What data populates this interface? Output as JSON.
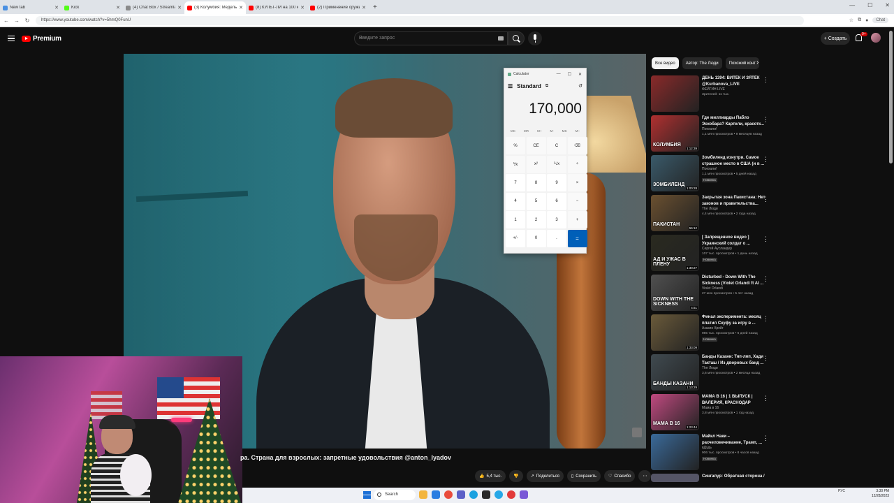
{
  "browser": {
    "tabs": [
      {
        "title": "New tab",
        "color": "#4a90e2",
        "active": false
      },
      {
        "title": "Kick",
        "color": "#53fc18",
        "active": false
      },
      {
        "title": "(4) Chat Box / Streamlabs",
        "color": "#8a8a8a",
        "active": false
      },
      {
        "title": "(3) Колумбия: Медельин Родин",
        "color": "#ff0000",
        "active": true
      },
      {
        "title": "(8) КУЛЬТ-ЛИ на 100 кг. МЫ ПРИ",
        "color": "#ff0000",
        "active": false
      },
      {
        "title": "(2) Применение оружия на ссаде",
        "color": "#ff0000",
        "active": false
      }
    ],
    "new_tab": "+",
    "url": "https://www.youtube.com/watch?v=5hmQ0FunU",
    "chat_button": "Chat"
  },
  "header": {
    "logo_text": "Premium",
    "search_placeholder": "Введите запрос",
    "create_label": "Создать",
    "notification_count": "9+"
  },
  "calculator": {
    "window_title": "Calculator",
    "mode": "Standard",
    "display": "170,000",
    "memory": [
      "MC",
      "MR",
      "M+",
      "M-",
      "MS",
      "M~"
    ],
    "keys": [
      "%",
      "CE",
      "C",
      "⌫",
      "⅟x",
      "x²",
      "²√x",
      "÷",
      "7",
      "8",
      "9",
      "×",
      "4",
      "5",
      "6",
      "−",
      "1",
      "2",
      "3",
      "+",
      "+/-",
      "0",
      ".",
      "="
    ]
  },
  "sidebar": {
    "chips": [
      "Все видео",
      "Автор: The Люди",
      "Похожий конт"
    ],
    "recommendations": [
      {
        "title": "ДЕНЬ 1394: ВИТЁК И ЗЯТЁК @Kurbanova_LIVE",
        "channel": "ФЕЙГИН LIVE",
        "meta": "Зрителей: 11 тыс.",
        "duration": "",
        "new": false,
        "thumb_text": "",
        "thumb_color": "#8a2a2a"
      },
      {
        "title": "Где миллиарды Пабло Эскобара? Картели, красотк...",
        "channel": "Поехали!",
        "meta": "1,1 млн просмотров • 9 месяцев назад",
        "duration": "1:12:39",
        "new": false,
        "thumb_text": "КОЛУМБИЯ",
        "thumb_color": "#b03030"
      },
      {
        "title": "Зомбиленд изнутри. Самое страшное место в США (и в ...",
        "channel": "Поехали!",
        "meta": "1,1 млн просмотров • 5 дней назад",
        "duration": "1:00:28",
        "new": true,
        "thumb_text": "ЗОМБИЛЕНД",
        "thumb_color": "#3a5a6a"
      },
      {
        "title": "Закрытая зона Пакистана: Нет законов и правительства...",
        "channel": "The Люди",
        "meta": "4,4 млн просмотров • 2 года назад",
        "duration": "56:12",
        "new": false,
        "thumb_text": "ПАКИСТАН",
        "thumb_color": "#6a5030"
      },
      {
        "title": "[ Запрещенное видео ] Украинский солдат о ...",
        "channel": "Сергей Аусландер",
        "meta": "107 тыс. просмотров • 1 день назад",
        "duration": "1:30:27",
        "new": true,
        "thumb_text": "АД И УЖАС В ПЛЕНУ",
        "thumb_color": "#2a2a20"
      },
      {
        "title": "Disturbed - Down With The Sickness (Violet Orlandi ft AI ...",
        "channel": "Violet Orlandi",
        "meta": "27 млн просмотров • 5 лет назад",
        "duration": "4:51",
        "new": false,
        "thumb_text": "DOWN WITH THE SICKNESS",
        "thumb_color": "#505050"
      },
      {
        "title": "Финал эксперимента: месяц платил Скуфу за игру в ...",
        "channel": "Азазин Крейг",
        "meta": "985 тыс. просмотров • 6 дней назад",
        "duration": "1:33:09",
        "new": true,
        "thumb_text": "",
        "thumb_color": "#6a5a3a"
      },
      {
        "title": "Банды Казани: Тяп-ляп, Хади Такташ / Из дворовых банд ...",
        "channel": "The Люди",
        "meta": "3,6 млн просмотров • 2 месяца назад",
        "duration": "1:13:29",
        "new": false,
        "thumb_text": "БАНДЫ КАЗАНИ",
        "thumb_color": "#404a50"
      },
      {
        "title": "МАМА В 16 | 1 ВЫПУСК | ВАЛЕРИЯ, КРАСНОДАР",
        "channel": "Мама в 16",
        "meta": "3,8 млн просмотров • 1 год назад",
        "duration": "1:23:44",
        "new": false,
        "thumb_text": "МАМА В 16",
        "thumb_color": "#c04a80"
      },
      {
        "title": "Майкл Наки – расчеловечивание, Трамп, ...",
        "channel": "вДудь",
        "meta": "906 тыс. просмотров • 8 часов назад",
        "duration": "",
        "new": true,
        "thumb_text": "",
        "thumb_color": "#3a6a9a"
      }
    ],
    "partial_next": "Сингапур: Обратная сторона /"
  },
  "video": {
    "title": "ра. Страна для взрослых: запретные удовольствия @anton_lyadov",
    "actions": {
      "like": "5,4 тыс.",
      "share": "Поделиться",
      "save": "Сохранить",
      "thanks": "Спасибо"
    }
  },
  "taskbar": {
    "search": "Search",
    "time": "3:30 PM",
    "date": "12/28/2023",
    "lang": "РУС"
  }
}
